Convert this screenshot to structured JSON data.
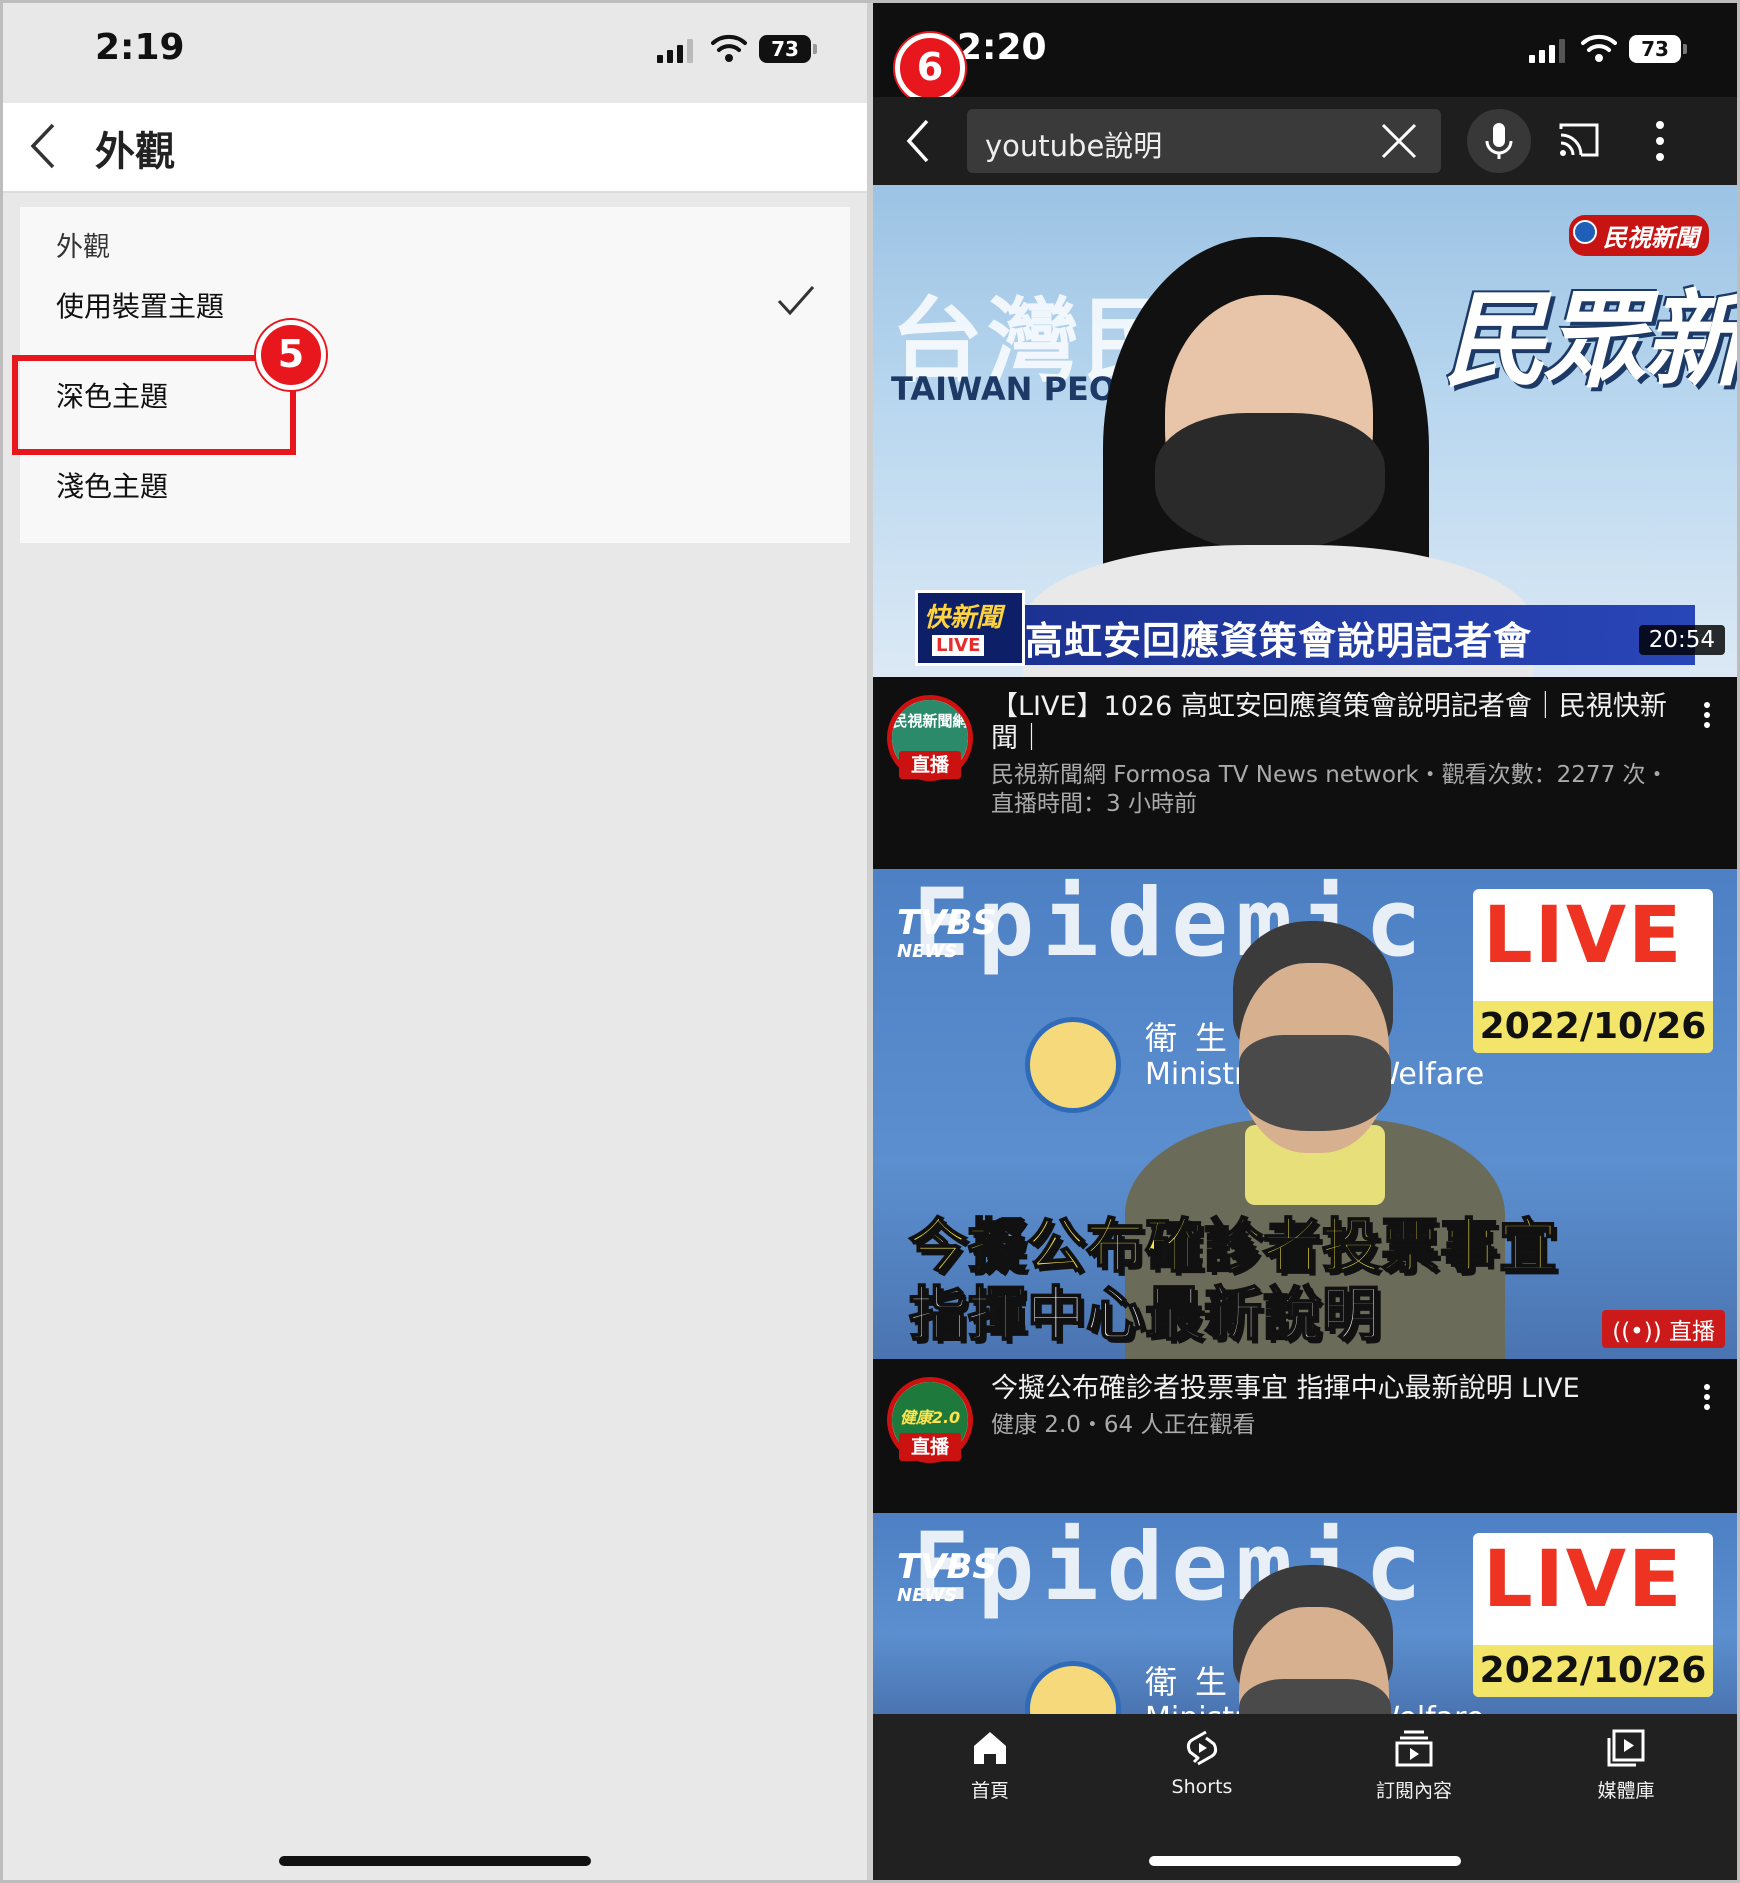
{
  "left": {
    "status": {
      "time": "2:19",
      "battery": "73"
    },
    "header": {
      "title": "外觀"
    },
    "section_label": "外觀",
    "options": [
      {
        "label": "使用裝置主題",
        "checked": true
      },
      {
        "label": "深色主題",
        "checked": false
      },
      {
        "label": "淺色主題",
        "checked": false
      }
    ],
    "step_badge": "5"
  },
  "right": {
    "status": {
      "time": "2:20",
      "battery": "73"
    },
    "step_badge": "6",
    "search": {
      "query": "youtube說明"
    },
    "videos": [
      {
        "thumb": {
          "bg_title": "台灣民",
          "bg_title_en": "TAIWAN PEOPL",
          "brand": "民視新聞",
          "big_text": "民眾新",
          "logo_a": "快新聞",
          "logo_b": "LIVE",
          "lower_third": "高虹安回應資策會說明記者會",
          "duration": "20:54"
        },
        "channel_avatar": "民視新聞網",
        "live_tag": "直播",
        "title": "【LIVE】1026 高虹安回應資策會說明記者會｜民視快新聞｜",
        "meta": "民視新聞網 Formosa TV News network・觀看次數：2277 次・直播時間：3 小時前"
      },
      {
        "thumb": {
          "bg_word": "Epidemic",
          "tvbs": "TVBS",
          "tvbs_sub": "NEWS",
          "live_word": "LIVE",
          "live_date": "2022/10/26",
          "ministry_zh": "衛生  部",
          "ministry_en": "Ministr   lth and Welfare",
          "caption1": "今擬公布確診者投票事宜",
          "caption2": "指揮中心最新說明",
          "live_chip": "((•)) 直播"
        },
        "channel_avatar": "健康2.0",
        "live_tag": "直播",
        "title": "今擬公布確診者投票事宜 指揮中心最新說明 LIVE",
        "meta": "健康 2.0・64 人正在觀看"
      },
      {
        "thumb": {
          "bg_word": "Epidemic",
          "tvbs": "TVBS",
          "tvbs_sub": "NEWS",
          "live_word": "LIVE",
          "live_date": "2022/10/26",
          "ministry_zh": "衛生  部",
          "ministry_en": "Ministr   lth and Welfare"
        }
      }
    ],
    "bottom_nav": [
      {
        "label": "首頁",
        "icon": "home-icon"
      },
      {
        "label": "Shorts",
        "icon": "shorts-icon"
      },
      {
        "label": "訂閱內容",
        "icon": "subscriptions-icon"
      },
      {
        "label": "媒體庫",
        "icon": "library-icon"
      }
    ]
  },
  "colors": {
    "accent_red": "#e8171d",
    "dark_bg": "#0f0f0f",
    "light_bg": "#e8e8e8"
  }
}
